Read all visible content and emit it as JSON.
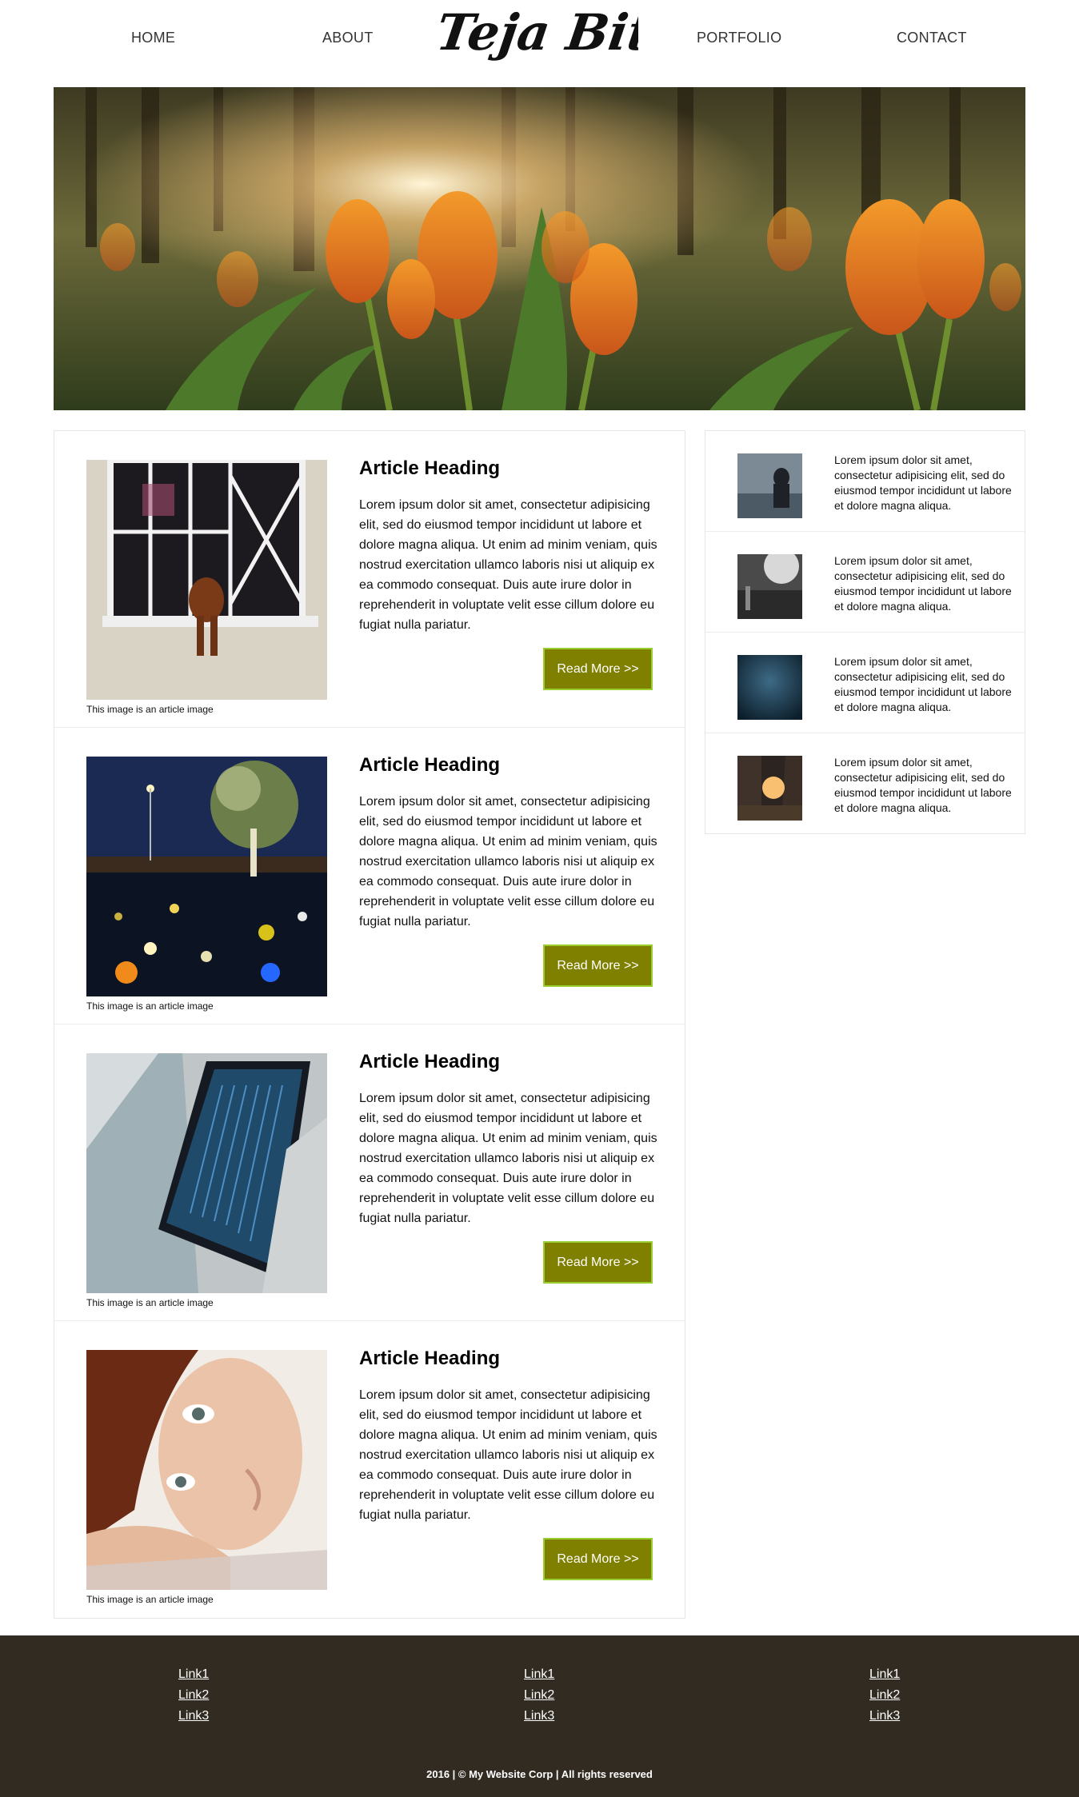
{
  "header": {
    "nav": [
      "HOME",
      "ABOUT",
      "PORTFOLIO",
      "CONTACT"
    ],
    "logo_text": "Teja Bitra"
  },
  "hero": {
    "alt": "tulip field banner"
  },
  "articles": [
    {
      "heading": "Article Heading",
      "body": "Lorem ipsum dolor sit amet, consectetur adipisicing elit, sed do eiusmod tempor incididunt ut labore et dolore magna aliqua. Ut enim ad minim veniam, quis nostrud exercitation ullamco laboris nisi ut aliquip ex ea commodo consequat. Duis aute irure dolor in reprehenderit in voluptate velit esse cillum dolore eu fugiat nulla pariatur.",
      "button": "Read More >>",
      "caption": "This image is an article image"
    },
    {
      "heading": "Article Heading",
      "body": "Lorem ipsum dolor sit amet, consectetur adipisicing elit, sed do eiusmod tempor incididunt ut labore et dolore magna aliqua. Ut enim ad minim veniam, quis nostrud exercitation ullamco laboris nisi ut aliquip ex ea commodo consequat. Duis aute irure dolor in reprehenderit in voluptate velit esse cillum dolore eu fugiat nulla pariatur.",
      "button": "Read More >>",
      "caption": "This image is an article image"
    },
    {
      "heading": "Article Heading",
      "body": "Lorem ipsum dolor sit amet, consectetur adipisicing elit, sed do eiusmod tempor incididunt ut labore et dolore magna aliqua. Ut enim ad minim veniam, quis nostrud exercitation ullamco laboris nisi ut aliquip ex ea commodo consequat. Duis aute irure dolor in reprehenderit in voluptate velit esse cillum dolore eu fugiat nulla pariatur.",
      "button": "Read More >>",
      "caption": "This image is an article image"
    },
    {
      "heading": "Article Heading",
      "body": "Lorem ipsum dolor sit amet, consectetur adipisicing elit, sed do eiusmod tempor incididunt ut labore et dolore magna aliqua. Ut enim ad minim veniam, quis nostrud exercitation ullamco laboris nisi ut aliquip ex ea commodo consequat. Duis aute irure dolor in reprehenderit in voluptate velit esse cillum dolore eu fugiat nulla pariatur.",
      "button": "Read More >>",
      "caption": "This image is an article image"
    }
  ],
  "sidebar": [
    {
      "text": "Lorem ipsum dolor sit amet, consectetur adipisicing elit, sed do eiusmod tempor incididunt ut labore et dolore magna aliqua."
    },
    {
      "text": "Lorem ipsum dolor sit amet, consectetur adipisicing elit, sed do eiusmod tempor incididunt ut labore et dolore magna aliqua."
    },
    {
      "text": "Lorem ipsum dolor sit amet, consectetur adipisicing elit, sed do eiusmod tempor incididunt ut labore et dolore magna aliqua."
    },
    {
      "text": "Lorem ipsum dolor sit amet, consectetur adipisicing elit, sed do eiusmod tempor incididunt ut labore et dolore magna aliqua."
    }
  ],
  "footer": {
    "columns": [
      [
        "Link1",
        "Link2",
        "Link3"
      ],
      [
        "Link1",
        "Link2",
        "Link3"
      ],
      [
        "Link1",
        "Link2",
        "Link3"
      ]
    ],
    "copyright": "2016 | © My Website Corp | All rights reserved"
  },
  "colors": {
    "button_bg": "#808000",
    "button_border": "#9acd32",
    "footer_bg": "#322b22"
  }
}
